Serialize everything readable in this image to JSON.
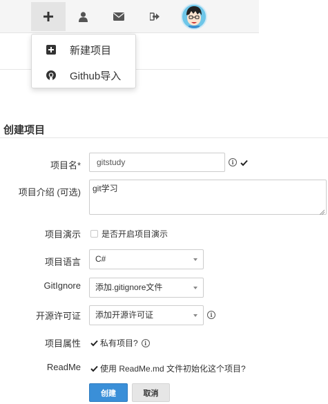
{
  "navbar": {
    "items": [
      {
        "icon": "plus-icon",
        "active": true
      },
      {
        "icon": "user-icon",
        "active": false
      },
      {
        "icon": "envelope-icon",
        "active": false
      },
      {
        "icon": "sign-out-icon",
        "active": false
      }
    ],
    "avatar": "avatar"
  },
  "dropdown": {
    "items": [
      {
        "icon": "plus-square-icon",
        "label": "新建项目"
      },
      {
        "icon": "github-icon",
        "label": "Github导入"
      }
    ]
  },
  "form": {
    "title": "创建项目",
    "name": {
      "label": "项目名*",
      "value": "gitstudy"
    },
    "description": {
      "label": "项目介绍 (可选)",
      "value": "git学习"
    },
    "demo": {
      "label": "项目演示",
      "checkbox_label": "是否开启项目演示",
      "checked": false
    },
    "language": {
      "label": "项目语言",
      "value": "C#"
    },
    "gitignore": {
      "label": "GitIgnore",
      "value": "添加.gitignore文件"
    },
    "license": {
      "label": "开源许可证",
      "value": "添加开源许可证"
    },
    "private": {
      "label": "项目属性",
      "checkbox_label": "私有项目?",
      "checked": true
    },
    "readme": {
      "label": "ReadMe",
      "checkbox_label": "使用 ReadMe.md 文件初始化这个项目?",
      "checked": true
    },
    "submit_label": "创建",
    "cancel_label": "取消"
  },
  "colors": {
    "primary": "#3a8fd8",
    "navbar_bg": "#f5f5f5"
  }
}
